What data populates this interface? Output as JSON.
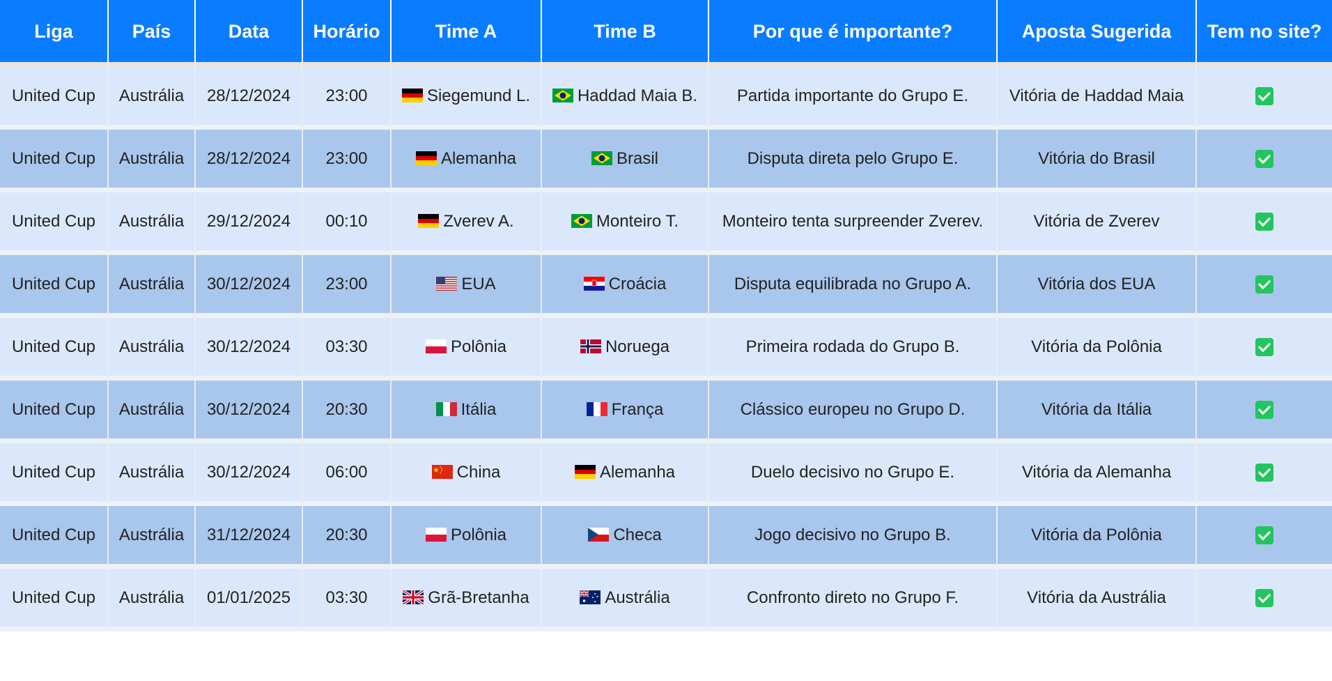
{
  "headers": [
    "Liga",
    "País",
    "Data",
    "Horário",
    "Time A",
    "Time B",
    "Por que é importante?",
    "Aposta Sugerida",
    "Tem no site?"
  ],
  "rows": [
    {
      "liga": "United Cup",
      "pais": "Austrália",
      "data": "28/12/2024",
      "horario": "23:00",
      "time_a": "Siegemund L.",
      "flag_a": "germany-flag-icon",
      "time_b": "Haddad Maia B.",
      "flag_b": "brazil-flag-icon",
      "motivo": "Partida importante do Grupo E.",
      "aposta": "Vitória de Haddad Maia",
      "no_site": "check-icon"
    },
    {
      "liga": "United Cup",
      "pais": "Austrália",
      "data": "28/12/2024",
      "horario": "23:00",
      "time_a": "Alemanha",
      "flag_a": "germany-flag-icon",
      "time_b": "Brasil",
      "flag_b": "brazil-flag-icon",
      "motivo": "Disputa direta pelo Grupo E.",
      "aposta": "Vitória do Brasil",
      "no_site": "check-icon"
    },
    {
      "liga": "United Cup",
      "pais": "Austrália",
      "data": "29/12/2024",
      "horario": "00:10",
      "time_a": "Zverev A.",
      "flag_a": "germany-flag-icon",
      "time_b": "Monteiro T.",
      "flag_b": "brazil-flag-icon",
      "motivo": "Monteiro tenta surpreender Zverev.",
      "aposta": "Vitória de Zverev",
      "no_site": "check-icon"
    },
    {
      "liga": "United Cup",
      "pais": "Austrália",
      "data": "30/12/2024",
      "horario": "23:00",
      "time_a": "EUA",
      "flag_a": "usa-flag-icon",
      "time_b": "Croácia",
      "flag_b": "croatia-flag-icon",
      "motivo": "Disputa equilibrada no Grupo A.",
      "aposta": "Vitória dos EUA",
      "no_site": "check-icon"
    },
    {
      "liga": "United Cup",
      "pais": "Austrália",
      "data": "30/12/2024",
      "horario": "03:30",
      "time_a": "Polônia",
      "flag_a": "poland-flag-icon",
      "time_b": "Noruega",
      "flag_b": "norway-flag-icon",
      "motivo": "Primeira rodada do Grupo B.",
      "aposta": "Vitória da Polônia",
      "no_site": "check-icon"
    },
    {
      "liga": "United Cup",
      "pais": "Austrália",
      "data": "30/12/2024",
      "horario": "20:30",
      "time_a": "Itália",
      "flag_a": "italy-flag-icon",
      "time_b": "França",
      "flag_b": "france-flag-icon",
      "motivo": "Clássico europeu no Grupo D.",
      "aposta": "Vitória da Itália",
      "no_site": "check-icon"
    },
    {
      "liga": "United Cup",
      "pais": "Austrália",
      "data": "30/12/2024",
      "horario": "06:00",
      "time_a": "China",
      "flag_a": "china-flag-icon",
      "time_b": "Alemanha",
      "flag_b": "germany-flag-icon",
      "motivo": "Duelo decisivo no Grupo E.",
      "aposta": "Vitória da Alemanha",
      "no_site": "check-icon"
    },
    {
      "liga": "United Cup",
      "pais": "Austrália",
      "data": "31/12/2024",
      "horario": "20:30",
      "time_a": "Polônia",
      "flag_a": "poland-flag-icon",
      "time_b": "Checa",
      "flag_b": "czech-flag-icon",
      "motivo": "Jogo decisivo no Grupo B.",
      "aposta": "Vitória da Polônia",
      "no_site": "check-icon"
    },
    {
      "liga": "United Cup",
      "pais": "Austrália",
      "data": "01/01/2025",
      "horario": "03:30",
      "time_a": "Grã-Bretanha",
      "flag_a": "uk-flag-icon",
      "time_b": "Austrália",
      "flag_b": "australia-flag-icon",
      "motivo": "Confronto direto no Grupo F.",
      "aposta": "Vitória da Austrália",
      "no_site": "check-icon"
    }
  ],
  "colors": {
    "header_bg": "#0a7cff",
    "row_light": "#dbe8fb",
    "row_dark": "#a9c6ec",
    "check": "#22c55e"
  }
}
